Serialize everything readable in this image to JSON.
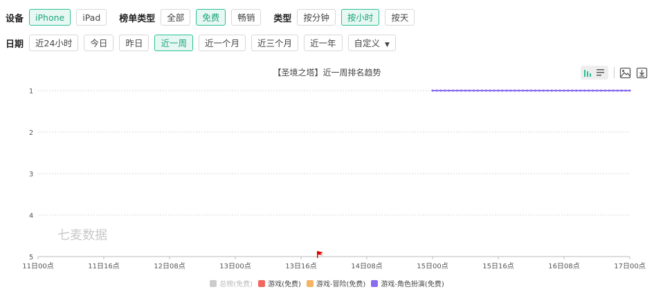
{
  "filters": {
    "device_label": "设备",
    "devices": [
      {
        "label": "iPhone",
        "active": true
      },
      {
        "label": "iPad",
        "active": false
      }
    ],
    "rank_type_label": "榜单类型",
    "rank_types": [
      {
        "label": "全部",
        "active": false
      },
      {
        "label": "免费",
        "active": true
      },
      {
        "label": "畅销",
        "active": false
      }
    ],
    "granularity_label": "类型",
    "granularities": [
      {
        "label": "按分钟",
        "active": false
      },
      {
        "label": "按小时",
        "active": true
      },
      {
        "label": "按天",
        "active": false
      }
    ],
    "date_label": "日期",
    "dates": [
      {
        "label": "近24小时",
        "active": false
      },
      {
        "label": "今日",
        "active": false
      },
      {
        "label": "昨日",
        "active": false
      },
      {
        "label": "近一周",
        "active": true
      },
      {
        "label": "近一个月",
        "active": false
      },
      {
        "label": "近三个月",
        "active": false
      },
      {
        "label": "近一年",
        "active": false
      },
      {
        "label": "自定义",
        "active": false
      }
    ]
  },
  "icons": {
    "dropdown": "caret-down-icon",
    "bar": "bar-chart-icon",
    "list": "list-icon",
    "image": "image-export-icon",
    "download": "download-icon",
    "marker": "flag-icon"
  },
  "colors": {
    "accent": "#2bbf94",
    "grid": "#d9d9d9",
    "series_total": "#cccccc",
    "series_games": "#f2675e",
    "series_adventure": "#f5b461",
    "series_rpg": "#8a6cf0"
  },
  "watermark": "七麦数据",
  "chart_data": {
    "type": "line",
    "title": "【圣境之塔】近一周排名趋势",
    "x_tick_labels": [
      "11日00点",
      "11日16点",
      "12日08点",
      "13日00点",
      "13日16点",
      "14日08点",
      "15日00点",
      "15日16点",
      "16日08点",
      "17日00点"
    ],
    "xlim_hours": [
      0,
      144
    ],
    "ylim": [
      5,
      1
    ],
    "y_ticks": [
      1,
      2,
      3,
      4,
      5
    ],
    "y_inverted": true,
    "grid": true,
    "legend_position": "bottom",
    "series": [
      {
        "name": "总榜(免费)",
        "color": "#cccccc",
        "disabled": true,
        "points": []
      },
      {
        "name": "游戏(免费)",
        "color": "#f2675e",
        "disabled": false,
        "points": []
      },
      {
        "name": "游戏-冒险(免费)",
        "color": "#f5b461",
        "disabled": false,
        "points": []
      },
      {
        "name": "游戏-角色扮演(免费)",
        "color": "#8a6cf0",
        "disabled": false,
        "points": [
          {
            "x_hours": 96,
            "y": 1
          },
          {
            "x_hours": 144,
            "y": 1
          }
        ]
      }
    ],
    "markers": [
      {
        "type": "flag",
        "x_hours": 68
      }
    ]
  }
}
